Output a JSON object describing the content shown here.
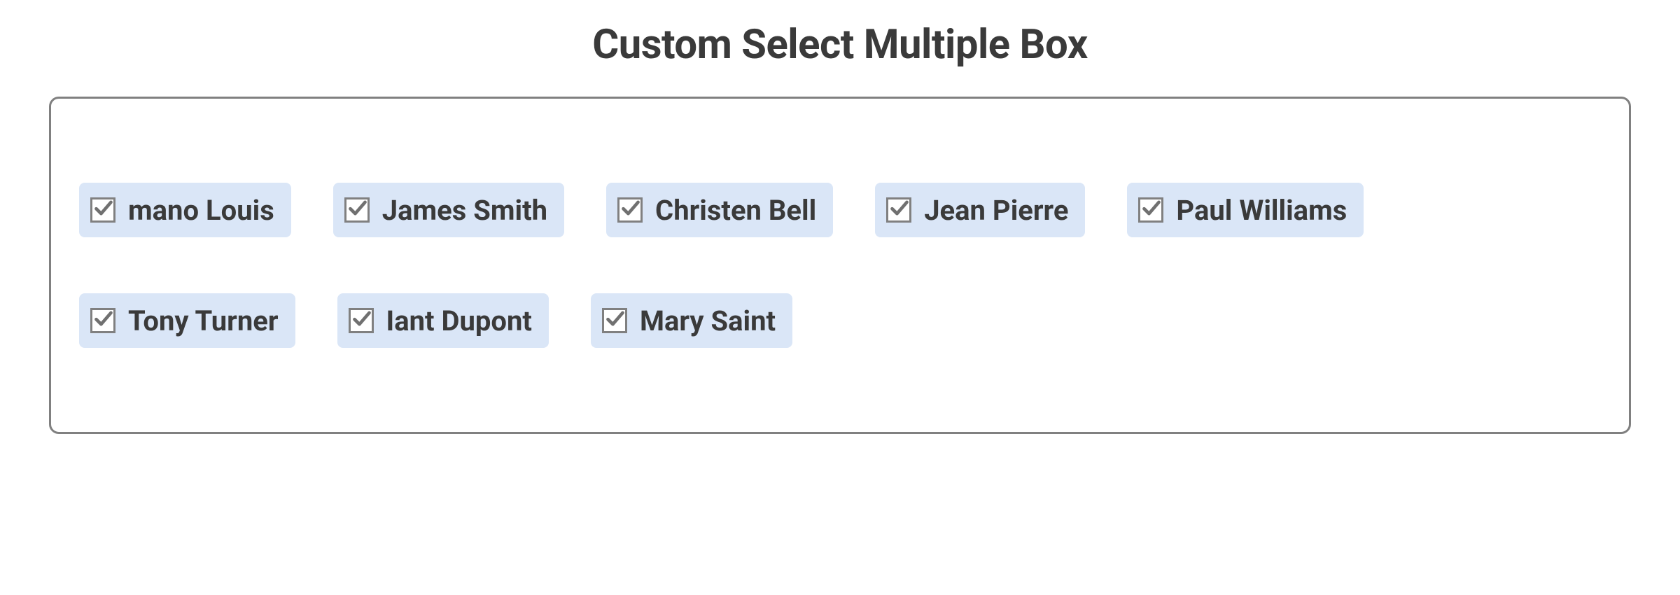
{
  "title": "Custom Select Multiple Box",
  "colors": {
    "chip_bg": "#dae6f7",
    "border": "#808080",
    "text": "#3a3a3a",
    "check": "#707070"
  },
  "items": [
    {
      "label": "mano Louis",
      "checked": true
    },
    {
      "label": "James Smith",
      "checked": true
    },
    {
      "label": "Christen Bell",
      "checked": true
    },
    {
      "label": "Jean Pierre",
      "checked": true
    },
    {
      "label": "Paul Williams",
      "checked": true
    },
    {
      "label": "Tony Turner",
      "checked": true
    },
    {
      "label": "Iant Dupont",
      "checked": true
    },
    {
      "label": "Mary Saint",
      "checked": true
    }
  ]
}
